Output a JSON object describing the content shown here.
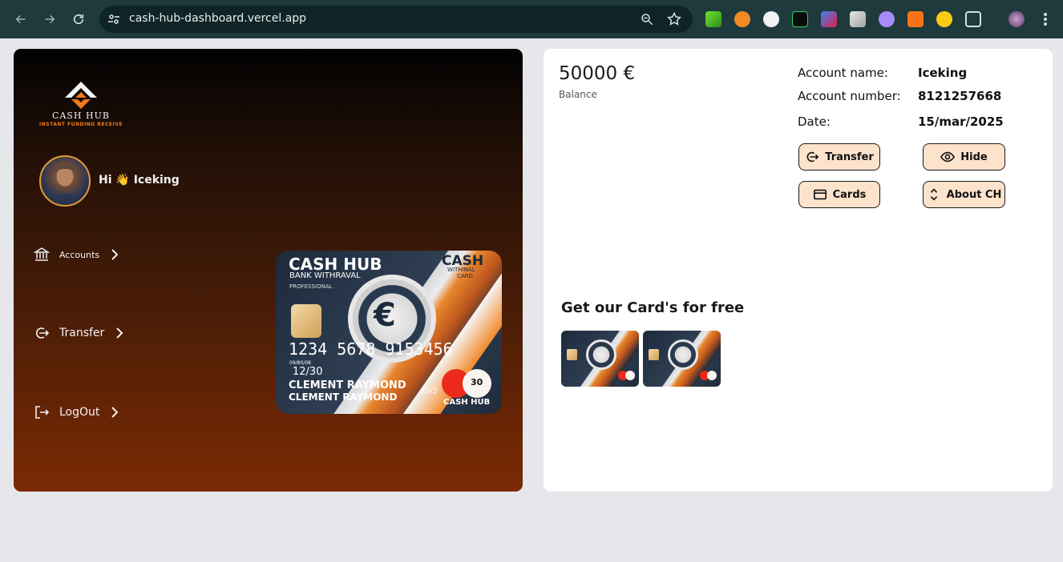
{
  "browser": {
    "url": "cash-hub-dashboard.vercel.app"
  },
  "brand": {
    "name": "CASH HUB",
    "tagline": "INSTANT FUNDING RECEIVE"
  },
  "user": {
    "greeting": "Hi 👋 Iceking"
  },
  "sidebar": {
    "items": [
      {
        "label": "Accounts",
        "icon": "bank-icon"
      },
      {
        "label": "Transfer",
        "icon": "transfer-icon"
      },
      {
        "label": "LogOut",
        "icon": "logout-icon"
      }
    ]
  },
  "card": {
    "brand": "CASH HUB",
    "subtitle": "BANK WITHRAVAL",
    "tier": "PROFESSIONAL",
    "corner_title": "CASH",
    "corner_sub": "WITHINAL",
    "corner_sub2": "CARD",
    "number": "1234 5678 9153456",
    "expiry_label": "09/80/08",
    "expiry": "12/30",
    "name1": "CLEMENT RAYMOND",
    "name2": "CLEMENT RAYMOND",
    "cvv_label": "CV3",
    "cvv": "30",
    "footer": "CASH HUB",
    "colors": {
      "dark": "#1d2a3c",
      "orange": "#f28a2b",
      "red": "#ec2a1b"
    }
  },
  "account": {
    "balance": "50000 €",
    "balance_label": "Balance",
    "rows": [
      {
        "label": "Account name:",
        "value": "Iceking"
      },
      {
        "label": "Account number:",
        "value": "8121257668"
      },
      {
        "label": "Date:",
        "value": "15/mar/2025"
      }
    ]
  },
  "actions": {
    "transfer": "Transfer",
    "hide": "Hide",
    "cards": "Cards",
    "about": "About CH"
  },
  "promo": {
    "title": "Get our Card's for free"
  },
  "colors": {
    "button_bg": "#fde2cc",
    "accent": "#f07a1a",
    "panel_bottom": "#7c2a03"
  }
}
